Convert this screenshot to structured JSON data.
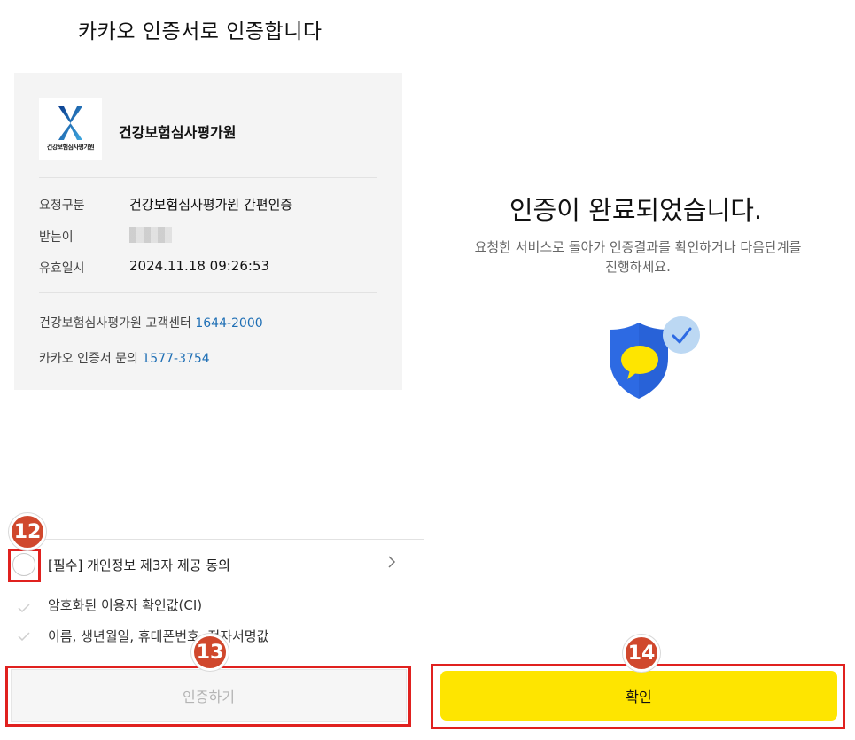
{
  "left": {
    "title": "카카오 인증서로 인증합니다",
    "org": {
      "logo_text": "건강보험심사평가원",
      "name": "건강보험심사평가원"
    },
    "info": [
      {
        "label": "요청구분",
        "value": "건강보험심사평가원 간편인증"
      },
      {
        "label": "받는이",
        "value": ""
      },
      {
        "label": "유효일시",
        "value": "2024.11.18 09:26:53"
      }
    ],
    "contacts": [
      {
        "label": "건강보험심사평가원 고객센터 ",
        "number": "1644-2000"
      },
      {
        "label": "카카오 인증서 문의 ",
        "number": "1577-3754"
      }
    ],
    "consent": {
      "main_label": "[필수] 개인정보 제3자 제공 동의",
      "items": [
        "암호화된 이용자 확인값(CI)",
        "이름, 생년월일, 휴대폰번호, 전자서명값"
      ]
    },
    "auth_button": "인증하기"
  },
  "right": {
    "title": "인증이 완료되었습니다.",
    "description_line1": "요청한 서비스로 돌아가 인증결과를 확인하거나 다음단계를",
    "description_line2": "진행하세요.",
    "confirm_button": "확인"
  },
  "annotations": {
    "badge12": "12",
    "badge13": "13",
    "badge14": "14"
  },
  "colors": {
    "kakao_yellow": "#FEE500",
    "link_blue": "#1F6FB5",
    "annotation_red": "#E0211F",
    "badge_orange": "#D0482D",
    "shield_blue": "#2D6AE3"
  }
}
